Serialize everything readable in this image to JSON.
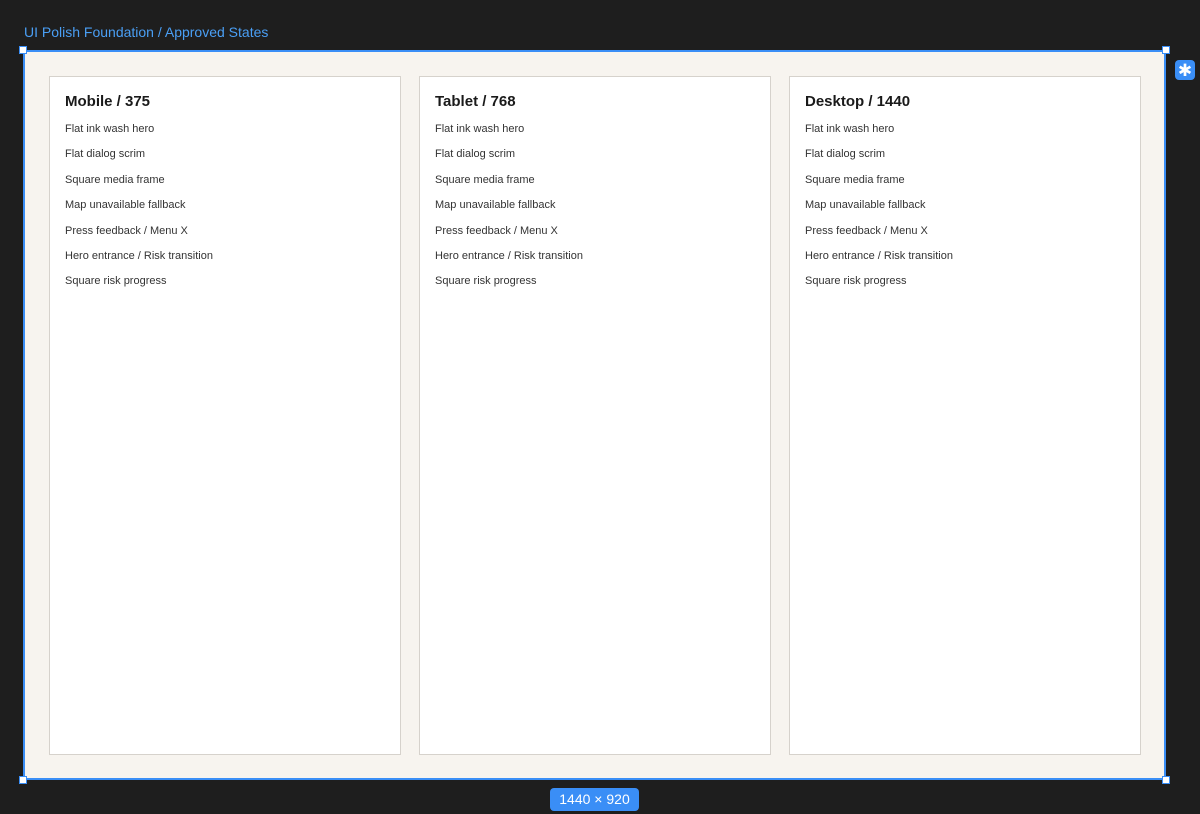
{
  "frame": {
    "title": "UI Polish Foundation / Approved States",
    "size_label": "1440 × 920",
    "accent_color": "#3a8ef6",
    "background_color": "#f7f4ef"
  },
  "plugin_button": {
    "glyph": "✱",
    "icon": "asterisk-icon"
  },
  "panels": [
    {
      "title": "Mobile / 375",
      "items": [
        "Flat ink wash hero",
        "Flat dialog scrim",
        "Square media frame",
        "Map unavailable fallback",
        "Press feedback / Menu X",
        "Hero entrance / Risk transition",
        "Square risk progress"
      ]
    },
    {
      "title": "Tablet / 768",
      "items": [
        "Flat ink wash hero",
        "Flat dialog scrim",
        "Square media frame",
        "Map unavailable fallback",
        "Press feedback / Menu X",
        "Hero entrance / Risk transition",
        "Square risk progress"
      ]
    },
    {
      "title": "Desktop / 1440",
      "items": [
        "Flat ink wash hero",
        "Flat dialog scrim",
        "Square media frame",
        "Map unavailable fallback",
        "Press feedback / Menu X",
        "Hero entrance / Risk transition",
        "Square risk progress"
      ]
    }
  ]
}
